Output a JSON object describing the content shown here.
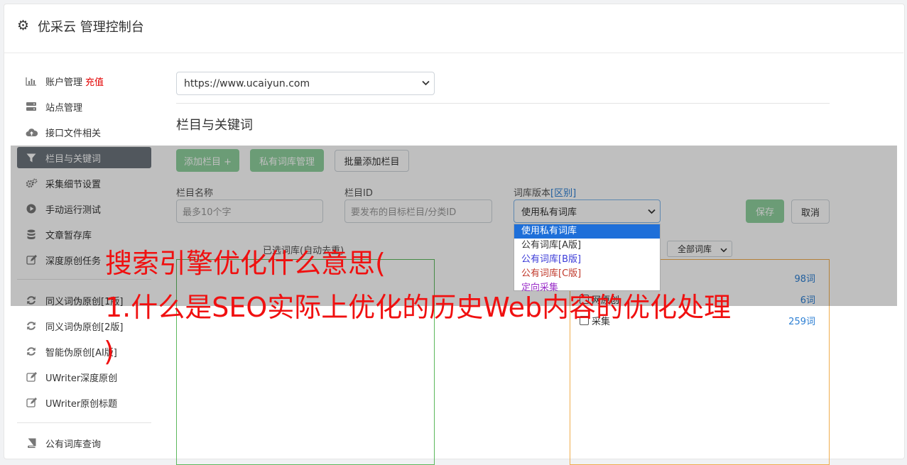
{
  "header": {
    "gear_icon": "gear-icon",
    "title": "优采云 管理控制台"
  },
  "sidebar": {
    "items": [
      {
        "icon": "bar-chart-icon",
        "label": "账户管理",
        "extra": "充值"
      },
      {
        "icon": "server-icon",
        "label": "站点管理"
      },
      {
        "icon": "cloud-upload-icon",
        "label": "接口文件相关"
      },
      {
        "icon": "filter-icon",
        "label": "栏目与关键词",
        "active": true
      },
      {
        "icon": "cogs-icon",
        "label": "采集细节设置"
      },
      {
        "icon": "play-circle-icon",
        "label": "手动运行测试"
      },
      {
        "icon": "database-icon",
        "label": "文章暂存库"
      },
      {
        "icon": "edit-icon",
        "label": "深度原创任务"
      },
      {
        "icon": "refresh-icon",
        "label": "同义词伪原创[1版]"
      },
      {
        "icon": "refresh-icon",
        "label": "同义词伪原创[2版]"
      },
      {
        "icon": "refresh-icon",
        "label": "智能伪原创[AI版]"
      },
      {
        "icon": "edit-icon",
        "label": "UWriter深度原创"
      },
      {
        "icon": "edit-icon",
        "label": "UWriter原创标题"
      },
      {
        "icon": "book-icon",
        "label": "公有词库查询"
      }
    ]
  },
  "main": {
    "site_select": {
      "value": "https://www.ucaiyun.com"
    },
    "section_title": "栏目与关键词",
    "buttons": {
      "add_column": "添加栏目 +",
      "private_lexicon": "私有词库管理",
      "batch_add": "批量添加栏目"
    },
    "form": {
      "column_name_label": "栏目名称",
      "column_name_placeholder": "最多10个字",
      "column_id_label": "栏目ID",
      "column_id_placeholder": "要发布的目标栏目/分类ID",
      "version_label": "词库版本",
      "version_link": "[区别]",
      "version_value": "使用私有词库",
      "save": "保存",
      "cancel": "取消"
    },
    "version_options": [
      {
        "label": "使用私有词库",
        "color": "#ffffff"
      },
      {
        "label": "公有词库[A版]",
        "color": "#333333"
      },
      {
        "label": "公有词库[B版]",
        "color": "#3b3bd8"
      },
      {
        "label": "公有词库[C版]",
        "color": "#c0392b"
      },
      {
        "label": "定向采集",
        "color": "#9b30c9"
      }
    ],
    "selected_lexicon_label": "已选词库(自动去重)",
    "lexicon_filter": "全部词库",
    "lexicon_rows": [
      {
        "name": "",
        "count": "98词",
        "checkbox": false
      },
      {
        "name": "网原创",
        "count": "6词",
        "checkbox": false
      },
      {
        "name": "采集",
        "count": "259词",
        "checkbox": true
      }
    ]
  },
  "overlay_text": {
    "line1": "搜索引擎优化什么意思(",
    "line2": "1.什么是SEO实际上优化的历史Web内容的优化处理",
    "line3": ")"
  }
}
